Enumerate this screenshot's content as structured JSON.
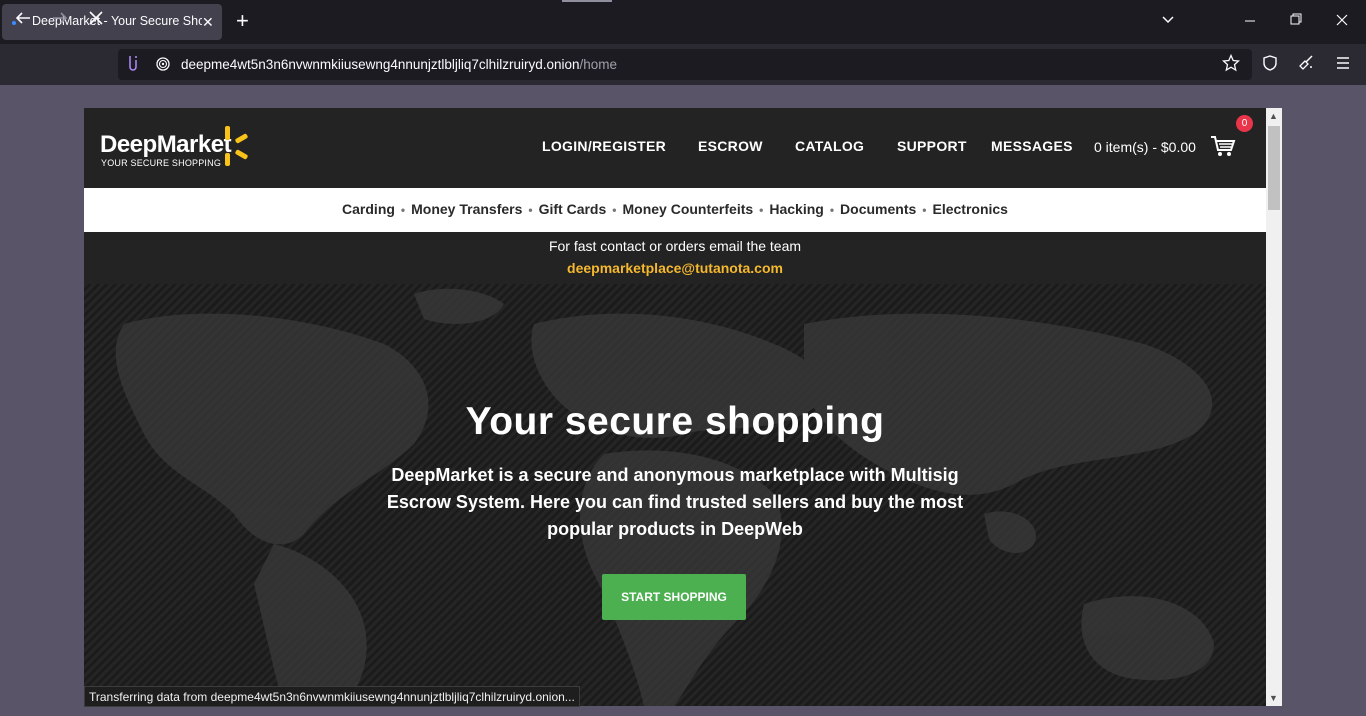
{
  "browser": {
    "tab_title": "DeepMarket - Your Secure Shopping",
    "tab_close": "✕",
    "new_tab": "+",
    "url_host": "deepme4wt5n3n6nvwnmkiiusewng4nnunjztlbljliq7clhilzruiryd.onion",
    "url_path": "/home",
    "status_text": "Transferring data from deepme4wt5n3n6nvwnmkiiusewng4nnunjztlbljliq7clhilzruiryd.onion..."
  },
  "site": {
    "logo_name": "DeepMarket",
    "logo_tagline": "YOUR SECURE SHOPPING",
    "menu": [
      "LOGIN/REGISTER",
      "ESCROW",
      "CATALOG",
      "SUPPORT",
      "MESSAGES"
    ],
    "cart_text": "0 item(s) - $0.00",
    "cart_badge": "0",
    "categories": [
      "Carding",
      "Money Transfers",
      "Gift Cards",
      "Money Counterfeits",
      "Hacking",
      "Documents",
      "Electronics"
    ],
    "contact_line": "For fast contact or orders email the team",
    "contact_email": "deepmarketplace@tutanota.com",
    "hero_title": "Your secure shopping",
    "hero_text": "DeepMarket is a secure and anonymous marketplace with Multisig Escrow System. Here you can find trusted sellers and buy the most popular products in DeepWeb",
    "cta_label": "START SHOPPING"
  },
  "colors": {
    "accent_yellow": "#f9c31a",
    "email": "#f5b82e",
    "cta_green": "#4caf50",
    "badge_red": "#e8354a"
  },
  "icons": [
    "back-arrow-icon",
    "forward-arrow-icon",
    "stop-loading-icon",
    "tor-circuit-icon",
    "onion-lock-icon",
    "bookmark-star-icon",
    "shield-icon",
    "broom-icon",
    "menu-icon",
    "cart-icon",
    "chevron-down-icon",
    "minimize-icon",
    "restore-icon",
    "close-icon"
  ]
}
